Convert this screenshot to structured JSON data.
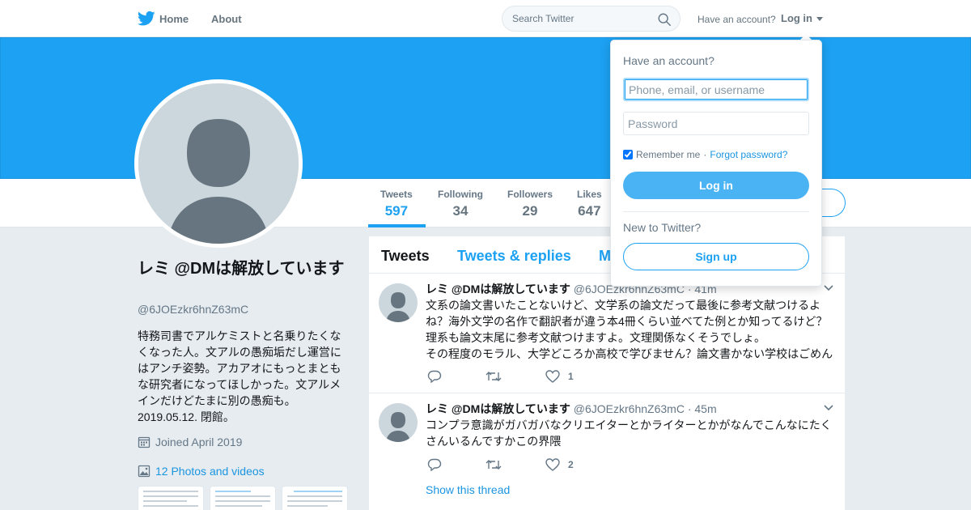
{
  "colors": {
    "brand": "#1da1f2",
    "link": "#1b95e0",
    "text": "#14171a",
    "muted": "#657786",
    "background": "#e6ecf0"
  },
  "topbar": {
    "logo_icon": "twitter-bird-icon",
    "home_label": "Home",
    "about_label": "About",
    "search_placeholder": "Search Twitter",
    "search_icon": "search-icon",
    "have_account_label": "Have an account?",
    "login_label": "Log in"
  },
  "profile": {
    "name": "レミ @DMは解放しています",
    "handle": "@6JOEzkr6hnZ63mC",
    "bio": "特務司書でアルケミストと名乗りたくなくなった人。文アルの愚痴垢だし運営にはアンチ姿勢。アカアオにもっとまともな研究者になってほしかった。文アルメインだけどたまに別の愚痴も。2019.05.12. 閉館。",
    "joined": "Joined April 2019",
    "photos_label": "12 Photos and videos"
  },
  "stats": [
    {
      "label": "Tweets",
      "value": "597"
    },
    {
      "label": "Following",
      "value": "34"
    },
    {
      "label": "Followers",
      "value": "29"
    },
    {
      "label": "Likes",
      "value": "647"
    }
  ],
  "timeline": {
    "tabs": [
      "Tweets",
      "Tweets & replies",
      "M"
    ],
    "tweets": [
      {
        "name": "レミ @DMは解放しています",
        "handle_time": "@6JOEzkr6hnZ63mC · 41m",
        "text": "文系の論文書いたことないけど、文学系の論文だって最後に参考文献つけるよね？海外文学の名作で翻訳者が違う本4冊くらい並べてた例とか知ってるけど？理系も論文末尾に参考文献つけますよ。文理関係なくそうでしょ。\nその程度のモラル、大学どころか高校で学びません？論文書かない学校はごめん",
        "likes": "1"
      },
      {
        "name": "レミ @DMは解放しています",
        "handle_time": "@6JOEzkr6hnZ63mC · 45m",
        "text": "コンプラ意識がガバガバなクリエイターとかライターとかがなんでこんなにたくさんいるんですかこの界隈",
        "likes": "2",
        "show_thread": "Show this thread"
      }
    ]
  },
  "login_dropdown": {
    "title": "Have an account?",
    "username_placeholder": "Phone, email, or username",
    "password_placeholder": "Password",
    "remember_label": "Remember me",
    "separator": "·",
    "forgot_label": "Forgot password?",
    "login_button": "Log in",
    "new_label": "New to Twitter?",
    "signup_button": "Sign up"
  }
}
